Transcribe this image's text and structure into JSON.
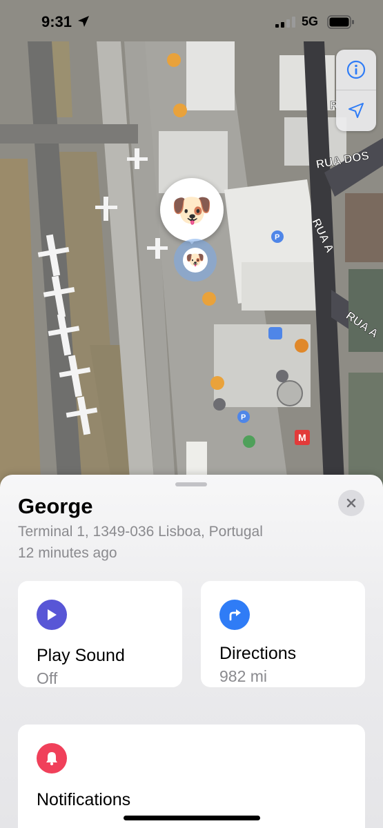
{
  "status_bar": {
    "time": "9:31",
    "network": "5G"
  },
  "map": {
    "street_labels": [
      "RUA DOS",
      "RUA A",
      "RUA A",
      "R"
    ],
    "device_emoji": "🐶",
    "controls": {
      "info_icon": "info-icon",
      "location_icon": "location-arrow-icon"
    }
  },
  "device": {
    "name": "George",
    "address": "Terminal 1, 1349-036 Lisboa, Portugal",
    "last_seen": "12 minutes ago"
  },
  "actions": {
    "play_sound": {
      "title": "Play Sound",
      "subtitle": "Off",
      "icon": "play-icon",
      "color": "#5856d6"
    },
    "directions": {
      "title": "Directions",
      "subtitle": "982 mi",
      "icon": "turn-right-arrow-icon",
      "color": "#2f7cf6"
    },
    "notifications": {
      "title": "Notifications",
      "icon": "bell-icon",
      "color": "#f0405a"
    }
  }
}
